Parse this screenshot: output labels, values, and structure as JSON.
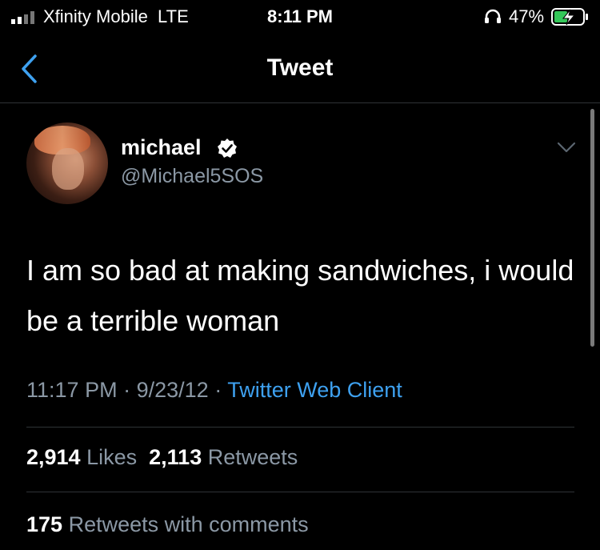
{
  "status_bar": {
    "carrier": "Xfinity Mobile  LTE",
    "time": "8:11 PM",
    "battery_percent": "47%"
  },
  "nav": {
    "title": "Tweet"
  },
  "tweet": {
    "display_name": "michael",
    "handle": "@Michael5SOS",
    "text": "I am so bad at making sandwiches, i would be a terrible woman",
    "time": "11:17 PM",
    "date": "9/23/12",
    "separator": "·",
    "client": "Twitter Web Client"
  },
  "stats": {
    "likes_count": "2,914",
    "likes_label": "Likes",
    "retweets_count": "2,113",
    "retweets_label": "Retweets",
    "quote_count": "175",
    "quote_label": "Retweets with comments"
  },
  "colors": {
    "accent": "#3ea1f0",
    "muted": "#8b98a5",
    "background": "#000000"
  }
}
